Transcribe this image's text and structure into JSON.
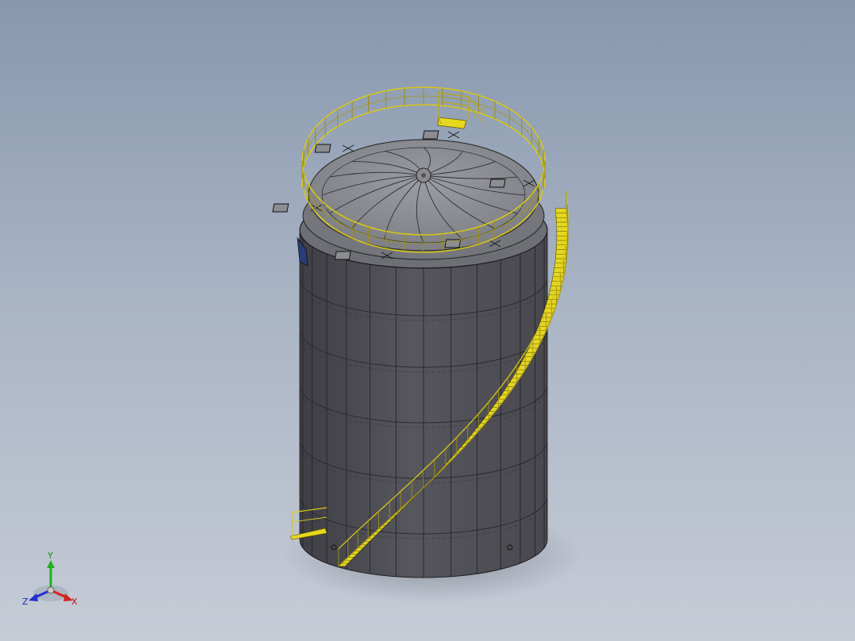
{
  "viewport": {
    "background_top": "#8797ad",
    "background_bottom": "#c6ccd6",
    "model_name": "",
    "body_color": "#4e4e55",
    "roof_color": "#8a8c92",
    "rail_color": "#d8c818",
    "stair_color": "#e6d81c"
  },
  "triad": {
    "x_label": "X",
    "y_label": "Y",
    "z_label": "Z",
    "x_color": "#d82020",
    "y_color": "#20b020",
    "z_color": "#2030d0"
  }
}
